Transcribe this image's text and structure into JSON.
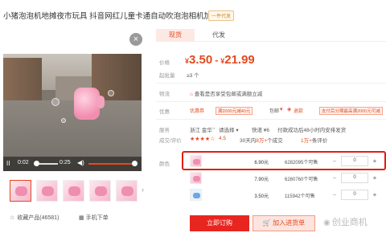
{
  "product": {
    "title": "小猪泡泡机地摊夜市玩具 抖音网红儿童卡通自动吹泡泡相机加特林",
    "badge": "一件代发"
  },
  "video": {
    "pause_icon": "II",
    "current_time": "0:02",
    "total_time": "0:25",
    "volume_icon": "◀)"
  },
  "thumbnails": {
    "count": 6,
    "selected": 0,
    "next_arrow": "›"
  },
  "footer_left": {
    "favorite": "收藏产品(46581)",
    "mobile": "手机下单"
  },
  "tabs": [
    {
      "label": "现货"
    },
    {
      "label": "代发"
    }
  ],
  "price": {
    "label": "价格",
    "currency": "¥",
    "low": "3.50",
    "high": "21.99"
  },
  "moq": {
    "label": "起批量",
    "value": "≥3 个"
  },
  "shipping": {
    "label": "物流",
    "value": "查看是否享受包邮或满额立减"
  },
  "promo": {
    "label": "优惠",
    "coupon_link": "优惠券",
    "tag1": "满2000元减40元",
    "item2": "包邮",
    "tag2": "满2000元减40元",
    "item3": "退款",
    "tag3": "支付后分期最高满2000元可减"
  },
  "service": {
    "label": "服务",
    "origin": "浙江 金华",
    "origin_select": "请选择",
    "express": "快递 ¥6",
    "promise": "付款成功后48小时内安排发货"
  },
  "record": {
    "label": "成交/评价",
    "stars": "★★★★☆",
    "score": "4.5",
    "monthly_prefix": "30天内",
    "monthly_count": "8万+",
    "monthly_suffix": "个成交",
    "reviews_count": "1万+",
    "reviews_suffix": "条评价"
  },
  "specs": {
    "label": "颜色",
    "rows": [
      {
        "price": "6.90元",
        "stock": "6282095个可售",
        "qty": "0"
      },
      {
        "price": "7.90元",
        "stock": "6280760个可售",
        "qty": "0"
      },
      {
        "price": "3.50元",
        "stock": "115942个可售",
        "qty": "0"
      }
    ]
  },
  "actions": {
    "buy": "立即订购",
    "cart": "加入进货单"
  },
  "watermark": "创业商机",
  "colors": {
    "accent": "#e24a1f",
    "highlight": "#e01e12"
  }
}
